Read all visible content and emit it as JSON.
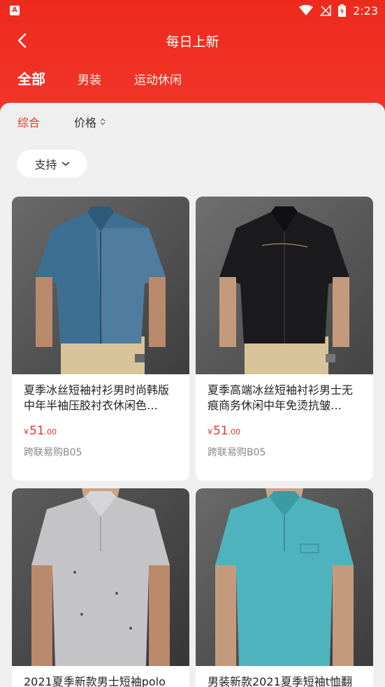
{
  "status": {
    "time": "2:23"
  },
  "header": {
    "title": "每日上新",
    "tabs": [
      {
        "label": "全部"
      },
      {
        "label": "男装"
      },
      {
        "label": "运动休闲"
      }
    ]
  },
  "sort": {
    "comprehensive": "综合",
    "price": "价格"
  },
  "filter": {
    "support": "支持"
  },
  "products": [
    {
      "name": "夏季冰丝短袖衬衫男时尚韩版中年半袖压胶衬衣休闲色…",
      "currency": "¥",
      "price_int": "51",
      "price_dec": ".00",
      "store": "跨联易购B05",
      "shirt_color": "#3d6f93"
    },
    {
      "name": "夏季高端冰丝短袖衬衫男士无痕商务休闲中年免烫抗皱…",
      "currency": "¥",
      "price_int": "51",
      "price_dec": ".00",
      "store": "跨联易购B05",
      "shirt_color": "#1b1b1d"
    },
    {
      "name": "2021夏季新款男士短袖polo",
      "shirt_color": "#c4c4c6"
    },
    {
      "name": "男装新款2021夏季短袖t恤翻",
      "shirt_color": "#4fb3bd"
    }
  ]
}
